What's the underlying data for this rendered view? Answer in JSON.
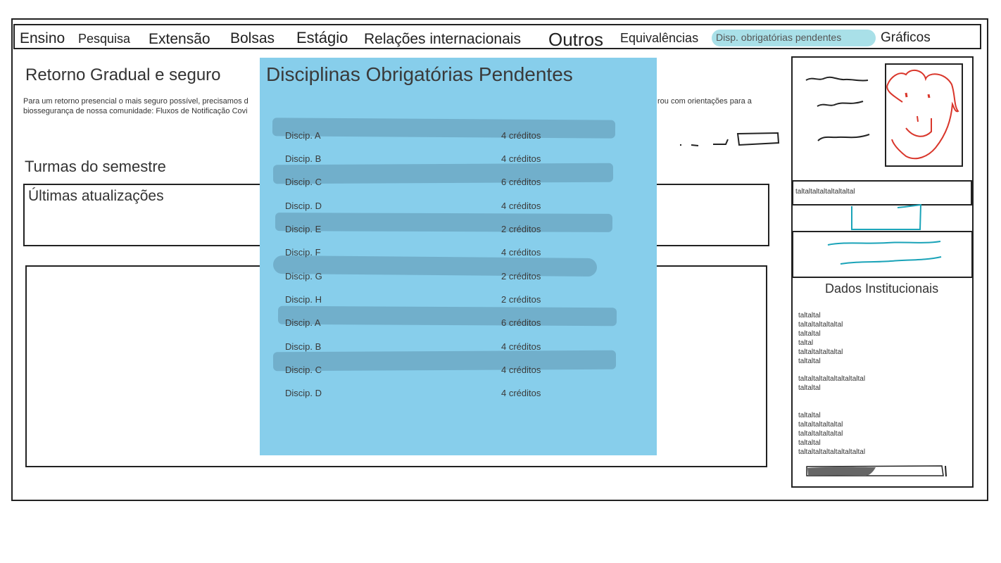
{
  "nav": {
    "items": [
      "Ensino",
      "Pesquisa",
      "Extensão",
      "Bolsas",
      "Estágio",
      "Relações internacionais",
      "Outros",
      "Equivalências",
      "Disp. obrigatórias pendentes",
      "Gráficos"
    ]
  },
  "main": {
    "retorno_title": "Retorno Gradual e seguro",
    "retorno_text_line1_left": "Para um retorno presencial o mais seguro possível, precisamos d",
    "retorno_text_line1_right": "rou com orientações para a",
    "retorno_text_line2": "biossegurança de nossa comunidade: Fluxos de Notificação Covi",
    "turmas_title": "Turmas do semestre",
    "ultimas_title": "Últimas atualizações"
  },
  "modal": {
    "title": "Disciplinas Obrigatórias Pendentes",
    "rows": [
      {
        "name": "Discip. A",
        "credits": "4 créditos"
      },
      {
        "name": "Discip. B",
        "credits": "4 créditos"
      },
      {
        "name": "Discip. C",
        "credits": "6 créditos"
      },
      {
        "name": "Discip. D",
        "credits": "4 créditos"
      },
      {
        "name": "Discip. E",
        "credits": "2 créditos"
      },
      {
        "name": "Discip. F",
        "credits": "4 créditos"
      },
      {
        "name": "Discip. G",
        "credits": "2 créditos"
      },
      {
        "name": "Discip. H",
        "credits": "2 créditos"
      },
      {
        "name": "Discip. A",
        "credits": "6 créditos"
      },
      {
        "name": "Discip. B",
        "credits": "4 créditos"
      },
      {
        "name": "Discip. C",
        "credits": "4 créditos"
      },
      {
        "name": "Discip. D",
        "credits": "4 créditos"
      }
    ]
  },
  "sidebar": {
    "profile_name": "taltaltaltaltaltaltaltal",
    "dados_title": "Dados Institucionais",
    "dados_lines": [
      "taltaltal",
      "taltaltaltaltaltal",
      "taltaltal",
      "taltal",
      "taltaltaltaltaltal",
      "taltaltal",
      "taltaltaltaltaltaltaltaltal",
      "taltaltal",
      "taltaltal",
      "taltaltaltaltaltal",
      "taltaltaltaltaltal",
      "taltaltal",
      "taltaltaltaltaltaltaltaltal"
    ]
  },
  "colors": {
    "modal_bg": "#87ceeb",
    "highlight": "#a9e0e8",
    "scribble_cyan": "#1aa3b8",
    "face_red": "#d9362b"
  }
}
